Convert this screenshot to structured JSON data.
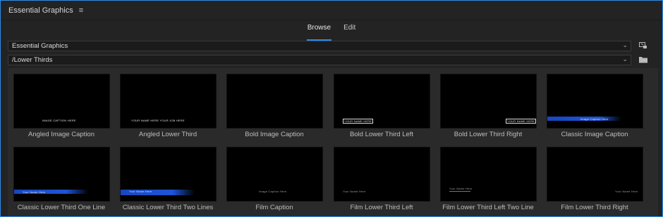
{
  "panel": {
    "title": "Essential Graphics",
    "menu_glyph": "≡"
  },
  "tabs": [
    {
      "label": "Browse",
      "active": true
    },
    {
      "label": "Edit",
      "active": false
    }
  ],
  "dropdowns": {
    "library": {
      "value": "Essential Graphics"
    },
    "folder": {
      "value": "/Lower Thirds"
    }
  },
  "templates": [
    {
      "label": "Angled Image Caption",
      "thumb_text": "IMAGE CAPTION HERE"
    },
    {
      "label": "Angled Lower Third",
      "thumb_text": "YOUR NAME HERE YOUR JOB HERE"
    },
    {
      "label": "Bold Image Caption",
      "thumb_text": ""
    },
    {
      "label": "Bold Lower Third Left",
      "thumb_text": "YOUR NAME HERE"
    },
    {
      "label": "Bold Lower Third Right",
      "thumb_text": "YOUR NAME HERE"
    },
    {
      "label": "Classic Image Caption",
      "thumb_text": "Image Caption Here"
    },
    {
      "label": "Classic Lower Third One Line",
      "thumb_text": "Your Name Here"
    },
    {
      "label": "Classic Lower Third Two Lines",
      "thumb_text": "Your Name Here"
    },
    {
      "label": "Film Caption",
      "thumb_text": "Image Caption Here"
    },
    {
      "label": "Film Lower Third Left",
      "thumb_text": "Your Name Here"
    },
    {
      "label": "Film Lower Third Left Two Line",
      "thumb_text": "Your Name Here"
    },
    {
      "label": "Film Lower Third Right",
      "thumb_text": "Your Name Here"
    }
  ],
  "colors": {
    "accent": "#2d8ceb",
    "panel_bg": "#232323",
    "grid_bg": "#2a2a2a",
    "bar_blue": "#1d55d8"
  }
}
